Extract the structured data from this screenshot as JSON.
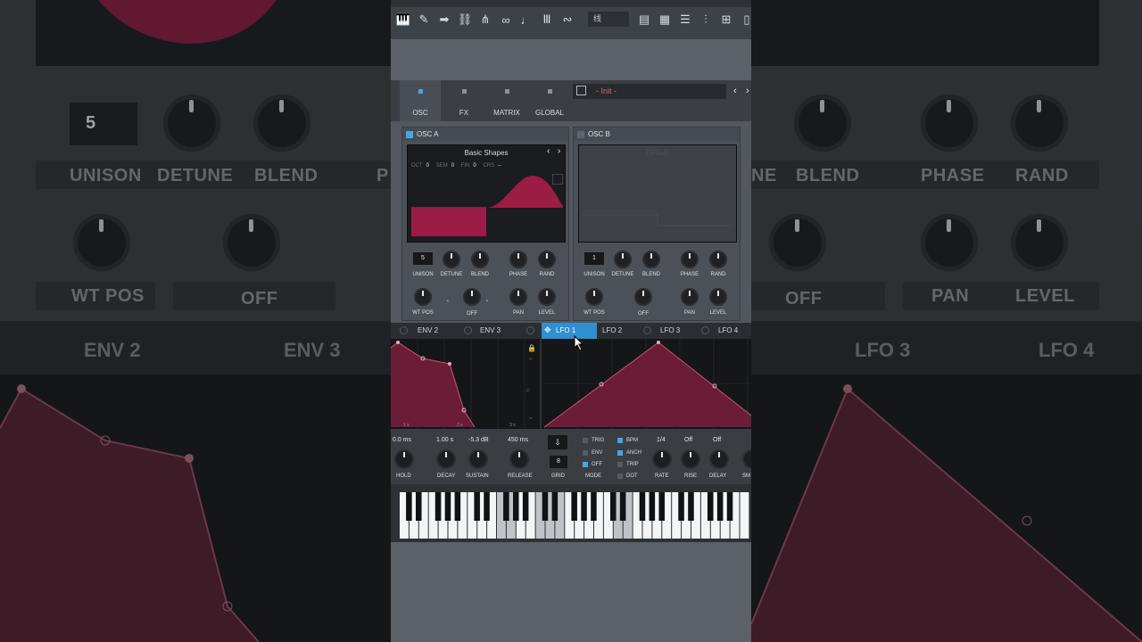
{
  "toolbar": {
    "field_value": "线",
    "icons": [
      "piano-icon",
      "brush-icon",
      "arrow-right-icon",
      "link-icon",
      "magnet-icon",
      "loop-icon",
      "tempo-icon",
      "mixer-icon",
      "loop2-icon",
      "meter-icon",
      "grid-icon",
      "browser-icon",
      "plugin-icon",
      "channel-icon"
    ]
  },
  "main_tabs": [
    {
      "label": "OSC",
      "active": true
    },
    {
      "label": "FX",
      "active": false
    },
    {
      "label": "MATRIX",
      "active": false
    },
    {
      "label": "GLOBAL",
      "active": false
    }
  ],
  "preset": {
    "name": "- Init -"
  },
  "osc_a": {
    "title": "OSC A",
    "enabled": true,
    "wavetable": "Basic Shapes",
    "params": [
      {
        "label": "OCT",
        "value": "0"
      },
      {
        "label": "SEM",
        "value": "0"
      },
      {
        "label": "FIN",
        "value": "0"
      },
      {
        "label": "CRS",
        "value": "--"
      }
    ],
    "unison": "5",
    "knobs_row1": [
      "UNISON",
      "DETUNE",
      "BLEND",
      "PHASE",
      "RAND"
    ],
    "knobs_row2": [
      "WT POS",
      "OFF",
      "PAN",
      "LEVEL"
    ]
  },
  "osc_b": {
    "title": "OSC B",
    "enabled": false,
    "wavetable": "Default",
    "unison": "1",
    "knobs_row1": [
      "UNISON",
      "DETUNE",
      "BLEND",
      "PHASE",
      "RAND"
    ],
    "knobs_row2": [
      "WT POS",
      "OFF",
      "PAN",
      "LEVEL"
    ]
  },
  "mod_tabs": [
    {
      "label": "ENV 2",
      "active": false
    },
    {
      "label": "ENV 3",
      "active": false
    },
    {
      "label": "LFO 1",
      "active": true
    },
    {
      "label": "LFO 2",
      "active": false
    },
    {
      "label": "LFO 3",
      "active": false
    },
    {
      "label": "LFO 4",
      "active": false
    }
  ],
  "envelope": {
    "values": [
      "0.0 ms",
      "1.00 s",
      "-5.3 dB",
      "450 ms"
    ],
    "labels": [
      "HOLD",
      "DECAY",
      "SUSTAIN",
      "RELEASE"
    ],
    "time_marks": [
      "1 s",
      "2 s",
      "3 s"
    ]
  },
  "lfo": {
    "grid_value": "8",
    "grid_label": "GRID",
    "mode_label": "MODE",
    "mode_options": [
      {
        "label": "TRIG",
        "on": false
      },
      {
        "label": "ENV",
        "on": false
      },
      {
        "label": "OFF",
        "on": true
      }
    ],
    "bpm_options": [
      {
        "label": "BPM",
        "on": true
      },
      {
        "label": "ANCH",
        "on": true
      },
      {
        "label": "TRIP",
        "on": false
      },
      {
        "label": "DOT",
        "on": false
      }
    ],
    "rate_value": "1/4",
    "rise_value": "Off",
    "delay_value": "Off",
    "knob_labels": [
      "RATE",
      "RISE",
      "DELAY",
      "SM"
    ]
  },
  "blurred_left": {
    "unison_value": "5",
    "labels": [
      "UNISON",
      "DETUNE",
      "BLEND",
      "WT POS",
      "OFF",
      "P"
    ],
    "tabs": [
      "ENV 2",
      "ENV 3"
    ]
  },
  "blurred_right": {
    "labels": [
      "NE",
      "BLEND",
      "PHASE",
      "RAND",
      "OFF",
      "PAN",
      "LEVEL"
    ],
    "tabs": [
      "LFO 3",
      "LFO 4"
    ]
  },
  "colors": {
    "accent": "#3fa9e8",
    "wave": "#9b1c45",
    "panel": "#4c5157"
  }
}
